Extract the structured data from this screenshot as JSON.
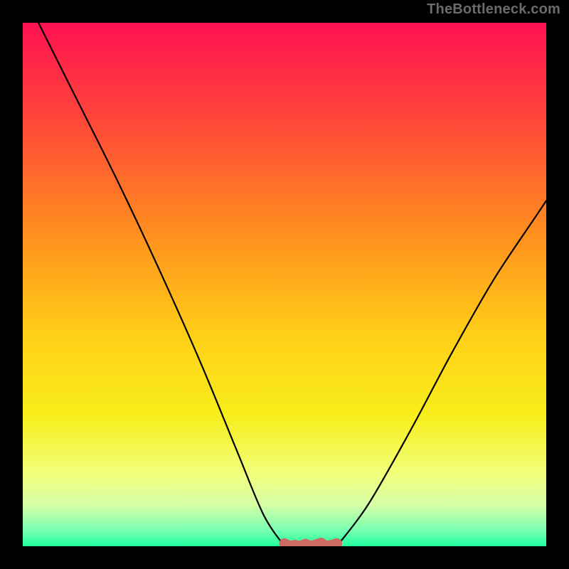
{
  "watermark": "TheBottleneck.com",
  "chart_data": {
    "type": "line",
    "title": "",
    "xlabel": "",
    "ylabel": "",
    "xlim": [
      0,
      100
    ],
    "ylim": [
      0,
      100
    ],
    "grid": false,
    "legend": false,
    "background_gradient": {
      "stops": [
        {
          "offset": 0,
          "color": "#ff1151"
        },
        {
          "offset": 20,
          "color": "#ff4b37"
        },
        {
          "offset": 40,
          "color": "#ff8e1e"
        },
        {
          "offset": 60,
          "color": "#ffd018"
        },
        {
          "offset": 75,
          "color": "#f7ee1a"
        },
        {
          "offset": 86,
          "color": "#f1ff7a"
        },
        {
          "offset": 92,
          "color": "#d7ffa6"
        },
        {
          "offset": 97,
          "color": "#77ffb1"
        },
        {
          "offset": 100,
          "color": "#1fff9e"
        }
      ]
    },
    "series": [
      {
        "name": "left-curve",
        "color": "#000000",
        "x": [
          3,
          10,
          18,
          26,
          34,
          41,
          46,
          50
        ],
        "y": [
          100,
          86,
          70,
          53,
          35,
          18,
          6,
          0
        ]
      },
      {
        "name": "right-curve",
        "color": "#000000",
        "x": [
          60,
          66,
          74,
          82,
          90,
          98,
          100
        ],
        "y": [
          0,
          8,
          22,
          37,
          51,
          63,
          66
        ]
      },
      {
        "name": "bottom-band",
        "color": "#cf6a63",
        "thick": true,
        "x": [
          50,
          51,
          52,
          53,
          54,
          55,
          56,
          57,
          58,
          59,
          60
        ],
        "y": [
          0.5,
          0,
          0.2,
          0,
          0.4,
          0,
          0.3,
          0.6,
          0,
          0.2,
          0.5
        ]
      }
    ]
  }
}
